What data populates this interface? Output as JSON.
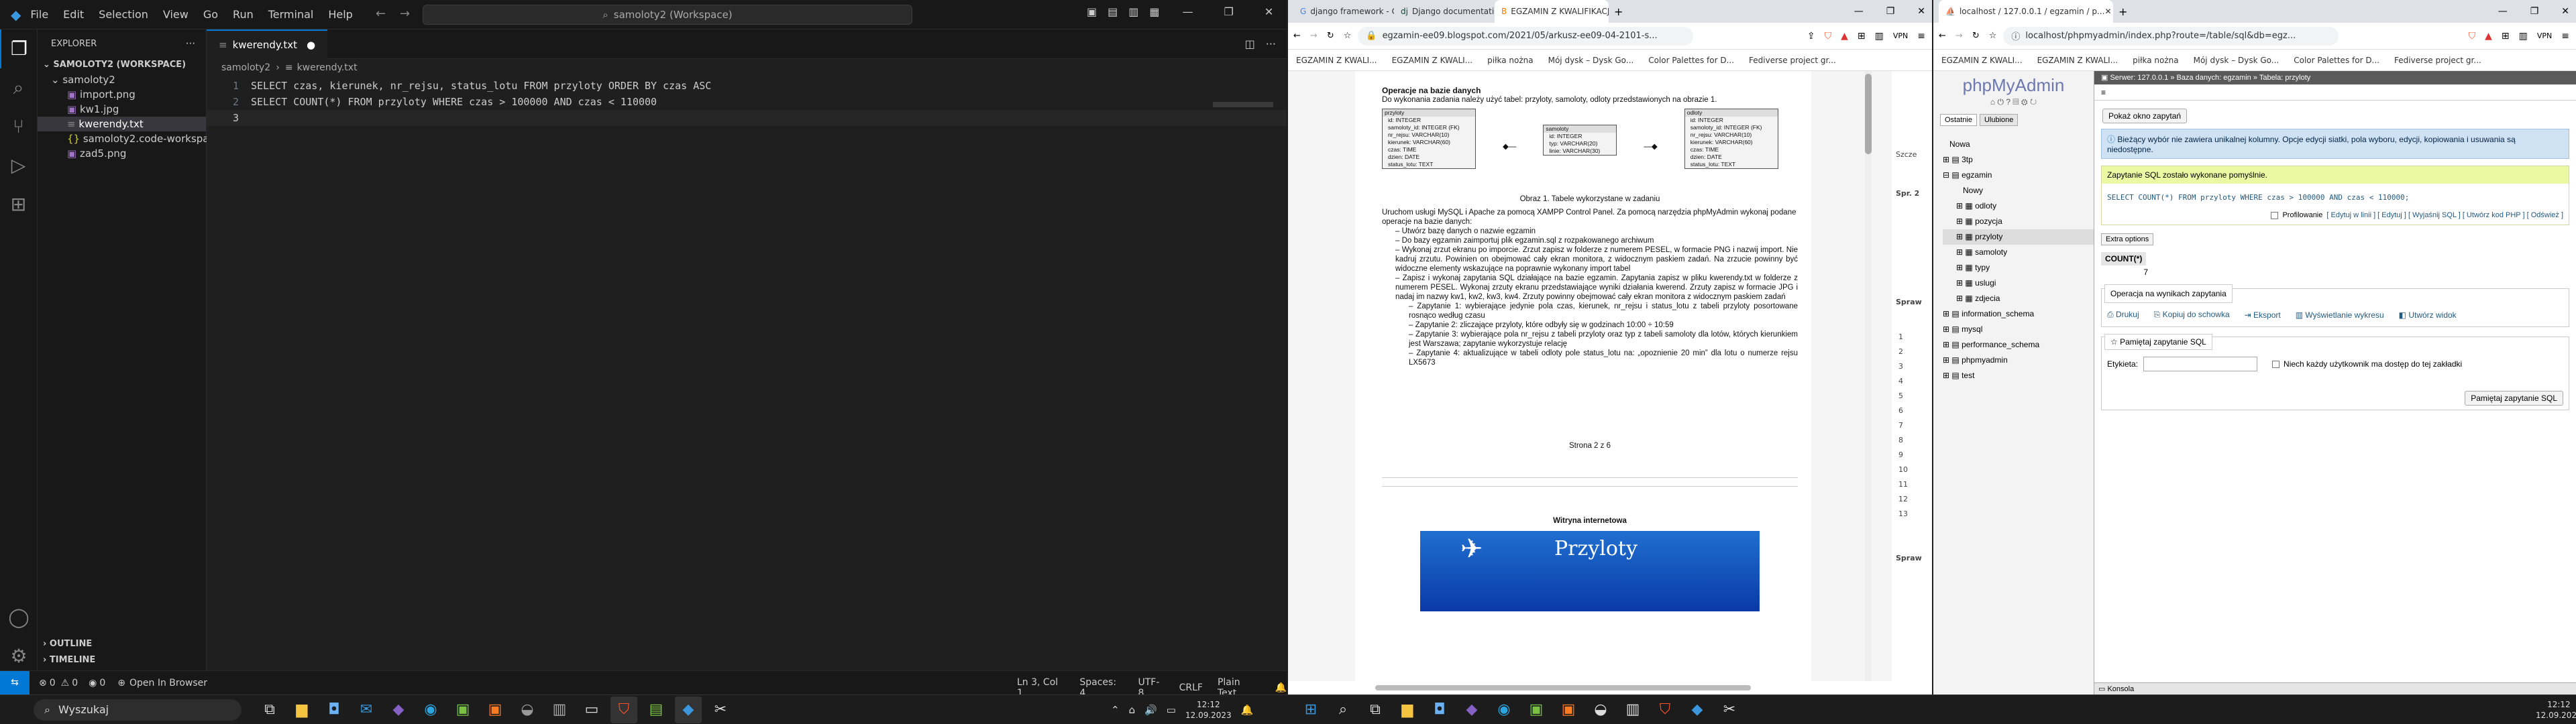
{
  "vscode": {
    "menu": [
      "File",
      "Edit",
      "Selection",
      "View",
      "Go",
      "Run",
      "Terminal",
      "Help"
    ],
    "command_center": "samoloty2 (Workspace)",
    "explorer_title": "EXPLORER",
    "workspace": "SAMOLOTY2 (WORKSPACE)",
    "folder": "samolotу2",
    "files": [
      "import.png",
      "kw1.jpg",
      "kwerendy.txt",
      "samoloty2.code-workspace",
      "zad5.png"
    ],
    "tab": "kwerendy.txt",
    "breadcrumb": [
      "samoloty2",
      "kwerendy.txt"
    ],
    "lines": [
      "SELECT czas, kierunek, nr_rejsu, status_lotu FROM przyloty ORDER BY czas ASC",
      "SELECT COUNT(*) FROM przyloty WHERE czas > 100000 AND czas < 110000",
      ""
    ],
    "outline": "OUTLINE",
    "timeline": "TIMELINE",
    "status": {
      "errors": "0",
      "warnings": "0",
      "ports": "0",
      "open_in_browser": "Open In Browser",
      "position": "Ln 3, Col 1",
      "spaces": "Spaces: 4",
      "encoding": "UTF-8",
      "eol": "CRLF",
      "language": "Plain Text"
    }
  },
  "browser1": {
    "tabs": [
      "django framework - Google Search",
      "Django documentation | Django d...",
      "EGZAMIN Z KWALIFIKACJI EE..."
    ],
    "url": "egzamin-ee09.blogspot.com/2021/05/arkusz-ee09-04-2101-s...",
    "bookmarks": [
      "EGZAMIN Z KWALI...",
      "EGZAMIN Z KWALI...",
      "piłka nożna",
      "Mój dysk – Dysk Go...",
      "Color Palettes for D...",
      "Fediverse project gr..."
    ],
    "heading": "Operacje na bazie danych",
    "intro": "Do wykonania zadania należy użyć tabel: przyloty, samoloty, odloty przedstawionych na obrazie 1.",
    "tables": [
      {
        "name": "przyloty",
        "fields": [
          "id: INTEGER",
          "samoloty_id: INTEGER (FK)",
          "nr_rejsu: VARCHAR(10)",
          "kierunek: VARCHAR(60)",
          "czas: TIME",
          "dzien: DATE",
          "status_lotu: TEXT"
        ]
      },
      {
        "name": "samoloty",
        "fields": [
          "id: INTEGER",
          "typ: VARCHAR(20)",
          "linie: VARCHAR(30)"
        ]
      },
      {
        "name": "odloty",
        "fields": [
          "id: INTEGER",
          "samoloty_id: INTEGER (FK)",
          "nr_rejsu: VARCHAR(10)",
          "kierunek: VARCHAR(60)",
          "czas: TIME",
          "dzien: DATE",
          "status_lotu: TEXT"
        ]
      }
    ],
    "caption": "Obraz 1. Tabele wykorzystane w zadaniu",
    "body": [
      "Uruchom usługi MySQL i Apache za pomocą XAMPP Control Panel. Za pomocą narzędzia phpMyAdmin wykonaj podane operacje na bazie danych:",
      "–  Utwórz bazę danych o nazwie egzamin",
      "–  Do bazy egzamin zaimportuj plik egzamin.sql z rozpakowanego archiwum",
      "–  Wykonaj zrzut ekranu po imporcie. Zrzut zapisz w folderze z numerem PESEL, w formacie PNG i nazwij import. Nie kadruj zrzutu. Powinien on obejmować cały ekran monitora, z widocznym paskiem zadań. Na zrzucie powinny być widoczne elementy wskazujące na poprawnie wykonany import tabel",
      "–  Zapisz i wykonaj zapytania SQL działające na bazie egzamin. Zapytania zapisz w pliku kwerendy.txt w folderze z numerem PESEL. Wykonaj zrzuty ekranu przedstawiające wyniki działania kwerend. Zrzuty zapisz w formacie JPG i nadaj im nazwy kw1, kw2, kw3, kw4. Zrzuty powinny obejmować cały ekran monitora z widocznym paskiem zadań",
      "–  Zapytanie 1: wybierające jedynie pola czas, kierunek, nr_rejsu i status_lotu z tabeli przyloty posortowane rosnąco według czasu",
      "–  Zapytanie 2: zliczające przyloty, które odbyły się w godzinach 10:00 ÷ 10:59",
      "–  Zapytanie 3: wybierające pola nr_rejsu z tabeli przyloty oraz typ z tabeli samoloty dla lotów, których kierunkiem jest Warszawa; zapytanie wykorzystuje relację",
      "–  Zapytanie 4: aktualizujące w tabeli odloty pole status_lotu na: „opoznienie 20 min” dla lotu o numerze rejsu LX5673"
    ],
    "page": "Strona 2 z 6",
    "section2": "Witryna internetowa",
    "banner": "Przyloty",
    "right_labels": [
      "Szcze",
      "Spr. 2",
      "Spraw",
      "Spraw"
    ],
    "right_nums": [
      "1",
      "2",
      "3",
      "4",
      "5",
      "6",
      "7",
      "8",
      "9",
      "10",
      "11",
      "12",
      "13"
    ]
  },
  "browser2": {
    "tab": "localhost / 127.0.0.1 / egzamin / p...",
    "url": "localhost/phpmyadmin/index.php?route=/table/sql&db=egz...",
    "bookmarks": [
      "EGZAMIN Z KWALI...",
      "EGZAMIN Z KWALI...",
      "piłka nożna",
      "Mój dysk – Dysk Go...",
      "Color Palettes for D...",
      "Fediverse project gr..."
    ],
    "logo": "phpMyAdmin",
    "nav_tabs": [
      "Ostatnie",
      "Ulubione"
    ],
    "breadcrumb": "Serwer: 127.0.0.1 » Baza danych: egzamin » Tabela: przyloty",
    "tree": [
      "Nowa",
      "3tp",
      "egzamin",
      "Nowy",
      "odloty",
      "pozycja",
      "przyloty",
      "samoloty",
      "typy",
      "uslugi",
      "zdjecia",
      "information_schema",
      "mysql",
      "performance_schema",
      "phpmyadmin",
      "test"
    ],
    "show_query": "Pokaż okno zapytań",
    "warning": "Bieżący wybór nie zawiera unikalnej kolumny. Opcje edycji siatki, pola wyboru, edycji, kopiowania i usuwania są niedostępne.",
    "success": "Zapytanie SQL zostało wykonane pomyślnie.",
    "sql": "SELECT COUNT(*) FROM przyloty WHERE czas > 100000 AND czas < 110000;",
    "profiling": "Profilowanie",
    "links": "[ Edytuj w linii ] [ Edytuj ] [ Wyjaśnij SQL ] [ Utwórz kod PHP ] [ Odśwież ]",
    "extra": "Extra options",
    "col": "COUNT(*)",
    "val": "7",
    "ops_title": "Operacja na wynikach zapytania",
    "ops": [
      "Drukuj",
      "Kopiuj do schowka",
      "Eksport",
      "Wyświetlanie wykresu",
      "Utwórz widok"
    ],
    "bookmark_title": "Pamiętaj zapytanie SQL",
    "label": "Etykieta:",
    "everyone": "Niech każdy użytkownik ma dostęp do tej zakładki",
    "save_btn": "Pamiętaj zapytanie SQL",
    "console": "Konsola"
  },
  "taskbar": {
    "search": "Wyszukaj",
    "time": "12:12",
    "date": "12.09.2023"
  }
}
